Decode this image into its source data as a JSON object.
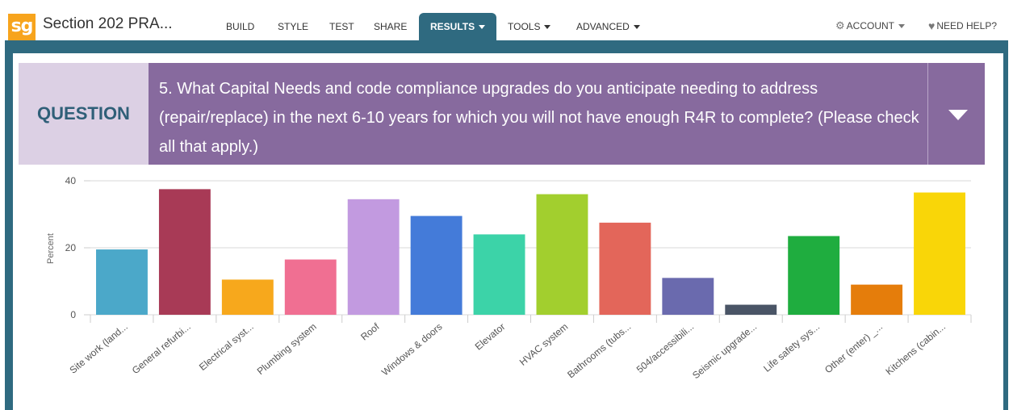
{
  "app": {
    "logo": "sg",
    "survey_title": "Section 202 PRA..."
  },
  "nav": {
    "build": "BUILD",
    "style": "STYLE",
    "test": "TEST",
    "share": "SHARE",
    "results": "RESULTS",
    "tools": "TOOLS",
    "advanced": "ADVANCED",
    "account": "ACCOUNT",
    "help": "NEED HELP?"
  },
  "question": {
    "label": "QUESTION",
    "text": "5. What Capital Needs and code compliance upgrades do you anticipate needing to address (repair/replace) in the next 6-10 years for which you will not have enough R4R to complete? (Please check all that apply.)"
  },
  "chart_data": {
    "type": "bar",
    "ylabel": "Percent",
    "ylim": [
      0,
      40
    ],
    "yticks": [
      0,
      20,
      40
    ],
    "grid": true,
    "categories": [
      "Site work (land...",
      "General refurbi...",
      "Electrical syst...",
      "Plumbing system",
      "Roof",
      "Windows & doors",
      "Elevator",
      "HVAC system",
      "Bathrooms (tubs...",
      "504/accessibili...",
      "Seismic upgrade...",
      "Life safety sys...",
      "Other (enter) _...",
      "Kitchens (cabin..."
    ],
    "values": [
      19.5,
      37.5,
      10.5,
      16.5,
      34.5,
      29.5,
      24,
      36,
      27.5,
      11,
      3,
      23.5,
      9,
      36.5
    ],
    "colors": [
      "#4ba8c9",
      "#a83a56",
      "#f7a81c",
      "#f06f92",
      "#c29ae0",
      "#447bd9",
      "#3cd3a8",
      "#a2cf2e",
      "#e3665a",
      "#6a6aae",
      "#4a5566",
      "#1fad3f",
      "#e57d0b",
      "#f9d608"
    ]
  }
}
